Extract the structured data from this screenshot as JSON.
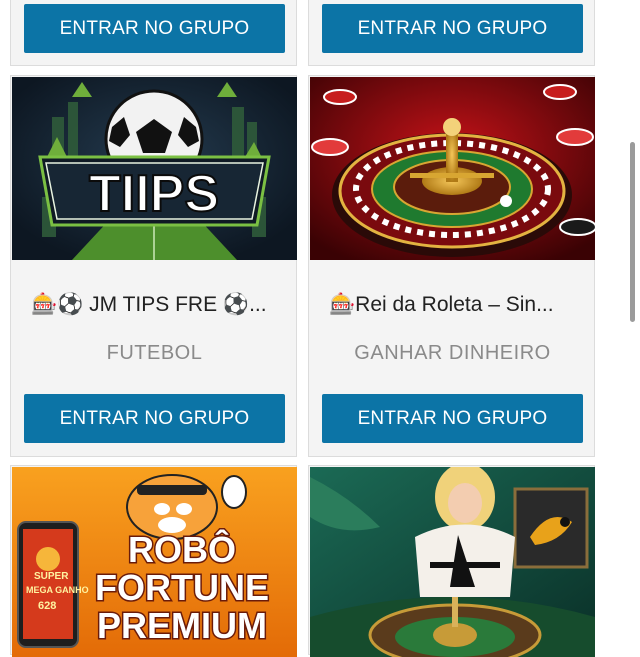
{
  "top_row": {
    "left_button": "ENTRAR NO GRUPO",
    "right_button": "ENTRAR NO GRUPO"
  },
  "cards": [
    {
      "title": "🎰⚽ JM TIPS FRE ⚽...",
      "category": "FUTEBOL",
      "button": "ENTRAR NO GRUPO",
      "image_text": "TIIPS"
    },
    {
      "title": "🎰Rei da Roleta – Sin...",
      "category": "GANHAR DINHEIRO",
      "button": "ENTRAR NO GRUPO"
    }
  ],
  "bottom_row": {
    "left_image_text": [
      "ROBÔ",
      "FORTUNE",
      "PREMIUM"
    ],
    "left_small_text": [
      "SUPER",
      "MEGA GANHO",
      "628"
    ]
  }
}
